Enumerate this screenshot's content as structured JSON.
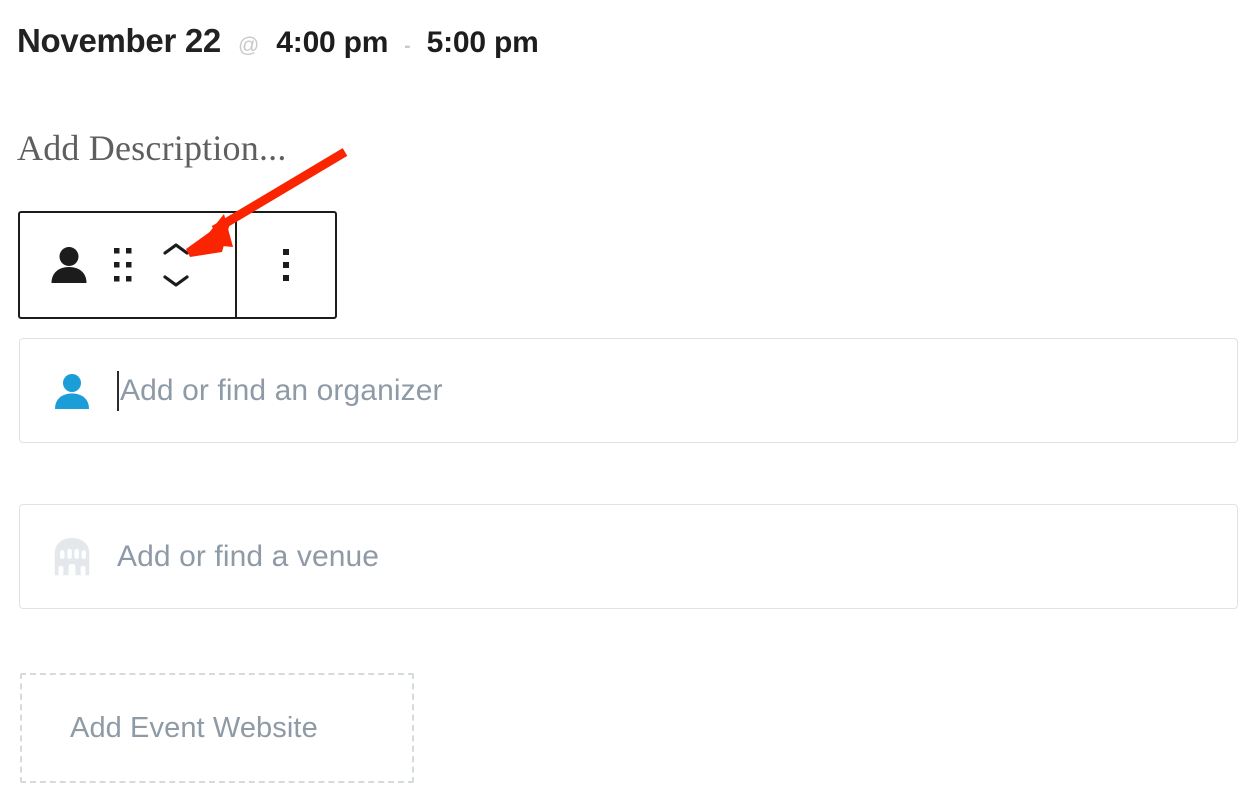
{
  "header": {
    "date": "November 22",
    "at_symbol": "@",
    "start_time": "4:00 pm",
    "separator": "-",
    "end_time": "5:00 pm"
  },
  "description": {
    "placeholder": "Add Description..."
  },
  "block_toolbar": {
    "person_icon": "person-icon",
    "drag_icon": "drag-handle-dots-icon",
    "move_up_icon": "chevron-up-icon",
    "move_down_icon": "chevron-down-icon",
    "more_icon": "kebab-menu-icon",
    "border_color": "#1c1c1c"
  },
  "organizer_field": {
    "icon": "person-icon",
    "icon_color": "#1b9ed8",
    "placeholder": "Add or find an organizer",
    "value": "",
    "has_caret": true
  },
  "venue_field": {
    "icon": "venue-building-icon",
    "icon_color": "#e4e8ec",
    "placeholder": "Add or find a venue",
    "value": ""
  },
  "add_website": {
    "label": "Add Event Website"
  },
  "annotation": {
    "color": "#fa2400",
    "points_to": "chevron-up-icon"
  },
  "colors": {
    "text_dark": "#1d1d1d",
    "text_muted": "#8e9aa6",
    "text_faint": "#c9c9c9",
    "field_border": "#dfe3e8",
    "dashed_border": "#d5dade",
    "accent_blue": "#1b9ed8",
    "annotation_red": "#fa2400"
  }
}
